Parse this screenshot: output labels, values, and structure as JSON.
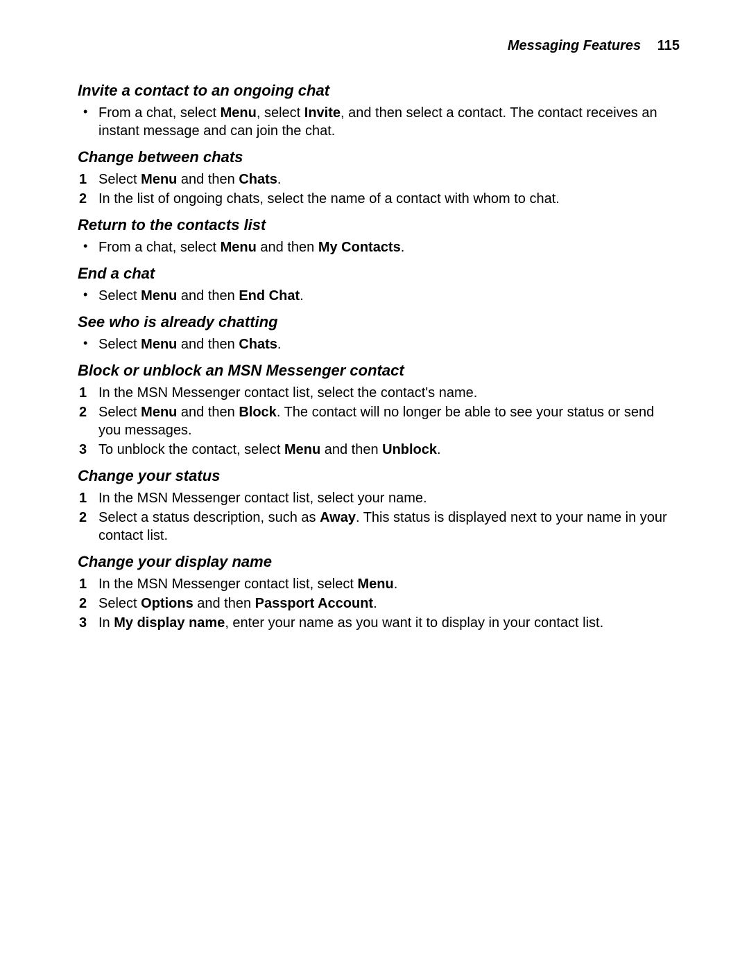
{
  "header": {
    "section_label": "Messaging Features",
    "page_number": "115"
  },
  "sections": {
    "invite": {
      "title": "Invite a contact to an ongoing chat",
      "item1_pre": "From a chat, select ",
      "item1_b1": "Menu",
      "item1_mid1": ", select ",
      "item1_b2": "Invite",
      "item1_post": ", and then select a contact. The contact receives an instant message and can join the chat."
    },
    "change_chats": {
      "title": "Change between chats",
      "step1_pre": "Select ",
      "step1_b1": "Menu",
      "step1_mid": " and then ",
      "step1_b2": "Chats",
      "step1_post": ".",
      "step2": "In the list of ongoing chats, select the name of a contact with whom to chat."
    },
    "return": {
      "title": "Return to the contacts list",
      "item1_pre": "From a chat, select ",
      "item1_b1": "Menu",
      "item1_mid": " and then ",
      "item1_b2": "My Contacts",
      "item1_post": "."
    },
    "end": {
      "title": "End a chat",
      "item1_pre": "Select ",
      "item1_b1": "Menu",
      "item1_mid": " and then ",
      "item1_b2": "End Chat",
      "item1_post": "."
    },
    "see_who": {
      "title": "See who is already chatting",
      "item1_pre": "Select ",
      "item1_b1": "Menu",
      "item1_mid": " and then ",
      "item1_b2": "Chats",
      "item1_post": "."
    },
    "block": {
      "title": "Block or unblock an MSN Messenger contact",
      "step1": "In the MSN Messenger contact list, select the contact's name.",
      "step2_pre": "Select ",
      "step2_b1": "Menu",
      "step2_mid": " and then ",
      "step2_b2": "Block",
      "step2_post": ". The contact will no longer be able to see your status or send you messages.",
      "step3_pre": "To unblock the contact, select ",
      "step3_b1": "Menu",
      "step3_mid": " and then ",
      "step3_b2": "Unblock",
      "step3_post": "."
    },
    "status": {
      "title": "Change your status",
      "step1": "In the MSN Messenger contact list, select your name.",
      "step2_pre": "Select a status description, such as ",
      "step2_b1": "Away",
      "step2_post": ". This status is displayed next to your name in your contact list."
    },
    "display_name": {
      "title": "Change your display name",
      "step1_pre": "In the MSN Messenger contact list, select ",
      "step1_b1": "Menu",
      "step1_post": ".",
      "step2_pre": "Select ",
      "step2_b1": "Options",
      "step2_mid": " and then ",
      "step2_b2": "Passport Account",
      "step2_post": ".",
      "step3_pre": "In ",
      "step3_b1": "My display name",
      "step3_post": ", enter your name as you want it to display in your contact list."
    }
  }
}
